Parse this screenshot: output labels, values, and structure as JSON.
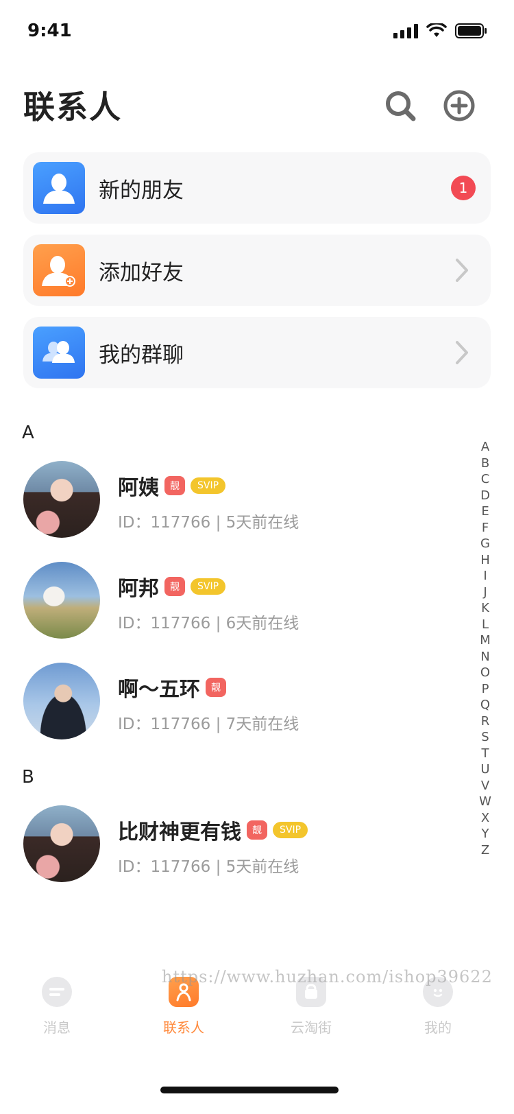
{
  "status_bar": {
    "time": "9:41"
  },
  "header": {
    "title": "联系人"
  },
  "menu": [
    {
      "label": "新的朋友",
      "badge": "1",
      "icon": "person-icon",
      "color": "#3b82f6"
    },
    {
      "label": "添加好友",
      "icon": "add-person-icon",
      "color": "#ff8a3d"
    },
    {
      "label": "我的群聊",
      "icon": "group-icon",
      "color": "#3b82f6"
    }
  ],
  "sections": [
    {
      "letter": "A",
      "contacts": [
        {
          "name": "阿姨",
          "tag_liang": "靓",
          "tag_svip": "SVIP",
          "id_label": "ID：117766",
          "status": "5天前在线"
        },
        {
          "name": "阿邦",
          "tag_liang": "靓",
          "tag_svip": "SVIP",
          "id_label": "ID：117766",
          "status": "6天前在线"
        },
        {
          "name": "啊～五环",
          "tag_liang": "靓",
          "id_label": "ID：117766",
          "status": "7天前在线"
        }
      ]
    },
    {
      "letter": "B",
      "contacts": [
        {
          "name": "比财神更有钱",
          "tag_liang": "靓",
          "tag_svip": "SVIP",
          "id_label": "ID：117766",
          "status": "5天前在线"
        }
      ]
    }
  ],
  "alpha_index": [
    "A",
    "B",
    "C",
    "D",
    "E",
    "F",
    "G",
    "H",
    "I",
    "J",
    "K",
    "L",
    "M",
    "N",
    "O",
    "P",
    "Q",
    "R",
    "S",
    "T",
    "U",
    "V",
    "W",
    "X",
    "Y",
    "Z"
  ],
  "tabbar": [
    {
      "label": "消息",
      "icon": "message-icon",
      "active": false
    },
    {
      "label": "联系人",
      "icon": "contacts-icon",
      "active": true
    },
    {
      "label": "云淘街",
      "icon": "shop-icon",
      "active": false
    },
    {
      "label": "我的",
      "icon": "profile-icon",
      "active": false
    }
  ],
  "watermark": "https://www.huzhan.com/ishop39622",
  "colors": {
    "accent": "#ff8a3d",
    "badge": "#f24a54",
    "tag_liang": "#f26560",
    "tag_svip": "#f3c52c"
  }
}
